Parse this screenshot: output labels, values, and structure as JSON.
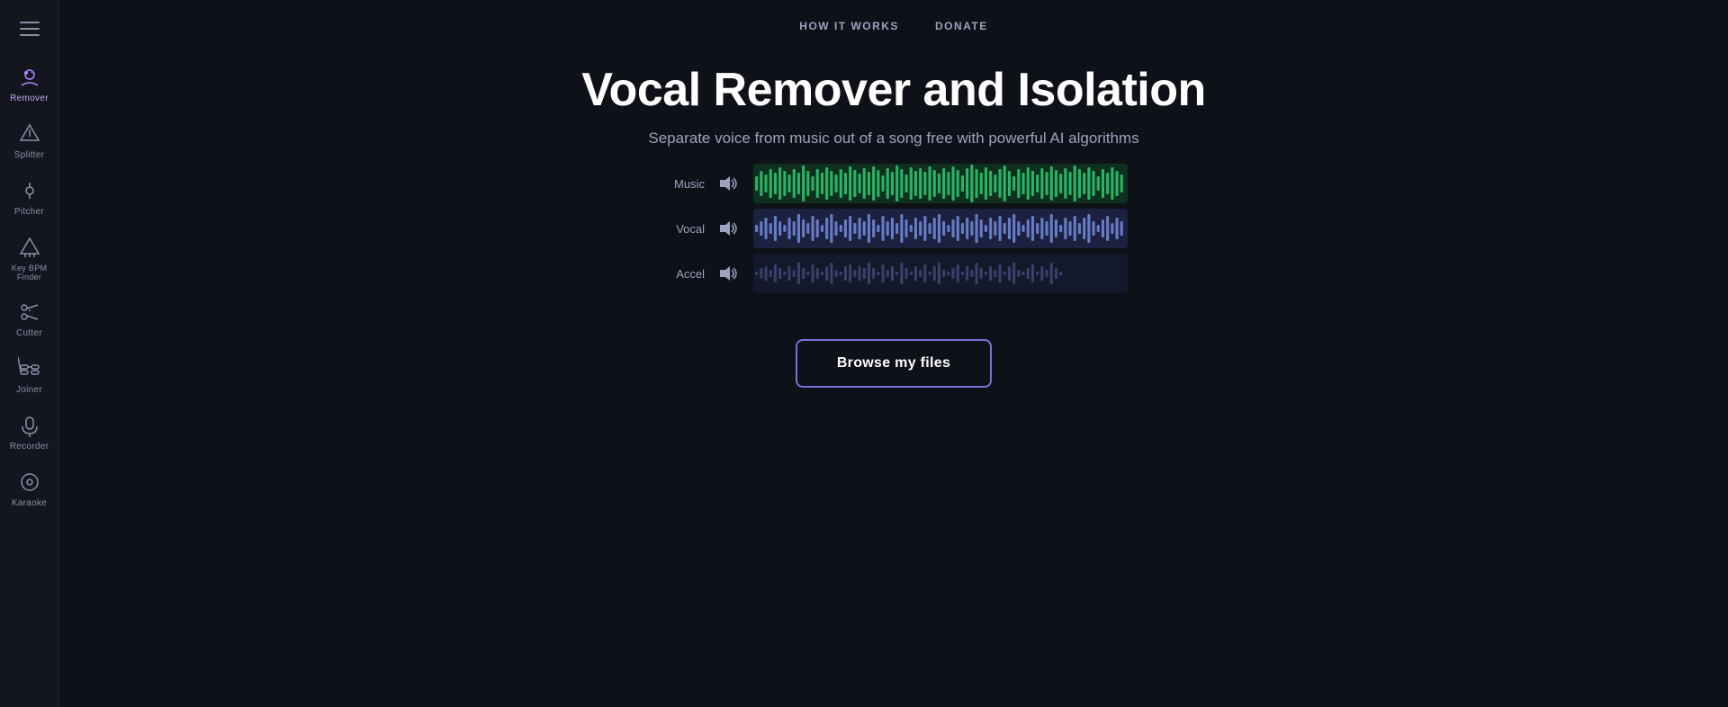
{
  "sidebar": {
    "menu_label": "menu",
    "items": [
      {
        "id": "remover",
        "label": "Remover",
        "icon": "remover-icon",
        "active": true
      },
      {
        "id": "splitter",
        "label": "Splitter",
        "icon": "splitter-icon",
        "active": false
      },
      {
        "id": "pitcher",
        "label": "Pitcher",
        "icon": "pitcher-icon",
        "active": false
      },
      {
        "id": "keybpm",
        "label": "Key BPM Finder",
        "icon": "keybpm-icon",
        "active": false
      },
      {
        "id": "cutter",
        "label": "Cutter",
        "icon": "cutter-icon",
        "active": false
      },
      {
        "id": "joiner",
        "label": "Joiner",
        "icon": "joiner-icon",
        "active": false
      },
      {
        "id": "recorder",
        "label": "Recorder",
        "icon": "recorder-icon",
        "active": false
      },
      {
        "id": "karaoke",
        "label": "Karaoke",
        "icon": "karaoke-icon",
        "active": false
      }
    ]
  },
  "topnav": {
    "links": [
      {
        "id": "how-it-works",
        "label": "HOW IT WORKS"
      },
      {
        "id": "donate",
        "label": "DONATE"
      }
    ]
  },
  "hero": {
    "title": "Vocal Remover and Isolation",
    "subtitle": "Separate voice from music out of a song free with powerful AI algorithms"
  },
  "waveform": {
    "tracks": [
      {
        "id": "music",
        "label": "Music",
        "type": "music"
      },
      {
        "id": "vocal",
        "label": "Vocal",
        "type": "vocal"
      },
      {
        "id": "accent",
        "label": "Accel",
        "type": "accent"
      }
    ]
  },
  "browse_button": {
    "label": "Browse my files"
  }
}
